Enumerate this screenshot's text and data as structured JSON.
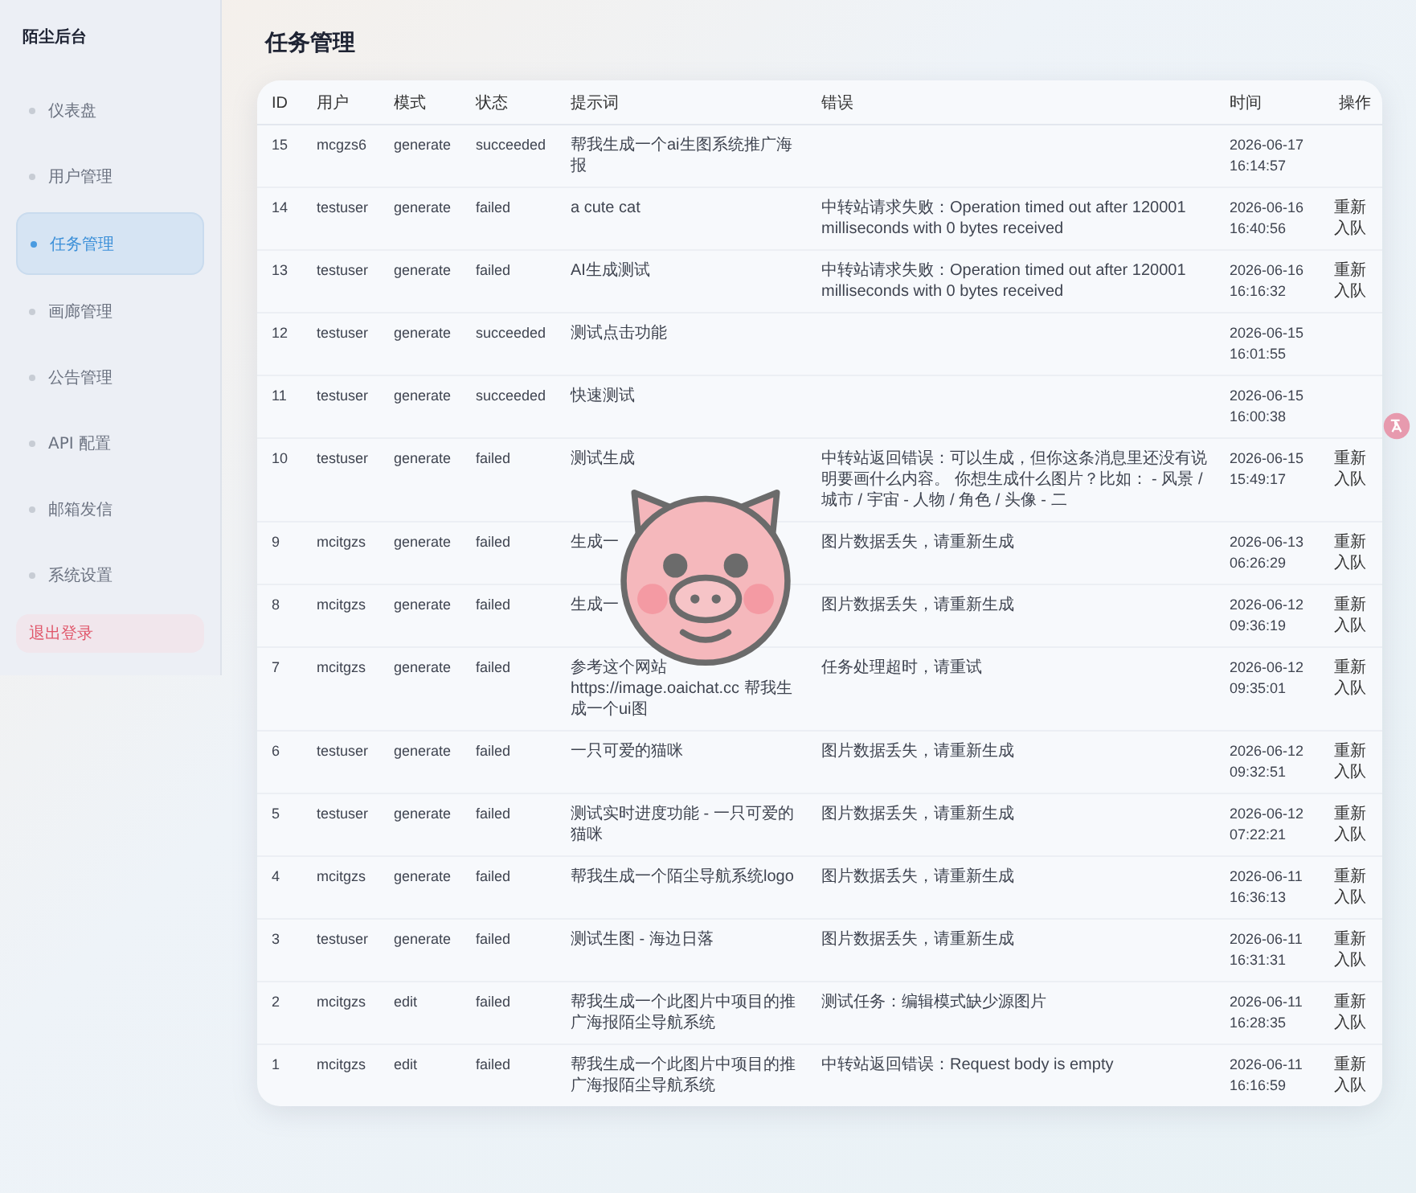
{
  "sidebar": {
    "title": "陌尘后台",
    "items": [
      {
        "label": "仪表盘",
        "selected": false
      },
      {
        "label": "用户管理",
        "selected": false
      },
      {
        "label": "任务管理",
        "selected": true
      },
      {
        "label": "画廊管理",
        "selected": false
      },
      {
        "label": "公告管理",
        "selected": false
      },
      {
        "label": "API 配置",
        "selected": false
      },
      {
        "label": "邮箱发信",
        "selected": false
      },
      {
        "label": "系统设置",
        "selected": false
      }
    ],
    "logout": "退出登录"
  },
  "page_title": "任务管理",
  "table": {
    "columns": [
      "ID",
      "用户",
      "模式",
      "状态",
      "提示词",
      "错误",
      "时间",
      "操作"
    ],
    "rows": [
      {
        "id": "15",
        "user": "mcgzs6",
        "mode": "generate",
        "status": "succeeded",
        "prompt": "帮我生成一个ai生图系统推广海报",
        "time": "2026-06-17 16:14:57"
      },
      {
        "id": "14",
        "user": "testuser",
        "mode": "generate",
        "status": "failed",
        "prompt": "a cute cat",
        "error": "中转站请求失败：Operation timed out after 120001 milliseconds with 0 bytes received",
        "time": "2026-06-16 16:40:56",
        "action": "重新入队"
      },
      {
        "id": "13",
        "user": "testuser",
        "mode": "generate",
        "status": "failed",
        "prompt": "AI生成测试",
        "error": "中转站请求失败：Operation timed out after 120001 milliseconds with 0 bytes received",
        "time": "2026-06-16 16:16:32",
        "action": "重新入队"
      },
      {
        "id": "12",
        "user": "testuser",
        "mode": "generate",
        "status": "succeeded",
        "prompt": "测试点击功能",
        "time": "2026-06-15 16:01:55"
      },
      {
        "id": "11",
        "user": "testuser",
        "mode": "generate",
        "status": "succeeded",
        "prompt": "快速测试",
        "time": "2026-06-15 16:00:38"
      },
      {
        "id": "10",
        "user": "testuser",
        "mode": "generate",
        "status": "failed",
        "prompt": "测试生成",
        "error": "中转站返回错误：可以生成，但你这条消息里还没有说明要画什么内容。 你想生成什么图片？比如： - 风景 / 城市 / 宇宙 - 人物 / 角色 / 头像 - 二",
        "time": "2026-06-15 15:49:17",
        "action": "重新入队"
      },
      {
        "id": "9",
        "user": "mcitgzs",
        "mode": "generate",
        "status": "failed",
        "prompt": "生成一",
        "error": "图片数据丢失，请重新生成",
        "time": "2026-06-13 06:26:29",
        "action": "重新入队"
      },
      {
        "id": "8",
        "user": "mcitgzs",
        "mode": "generate",
        "status": "failed",
        "prompt": "生成一",
        "error": "图片数据丢失，请重新生成",
        "time": "2026-06-12 09:36:19",
        "action": "重新入队"
      },
      {
        "id": "7",
        "user": "mcitgzs",
        "mode": "generate",
        "status": "failed",
        "prompt": "参考这个网站 https://image.oaichat.cc 帮我生成一个ui图",
        "error": "任务处理超时，请重试",
        "time": "2026-06-12 09:35:01",
        "action": "重新入队"
      },
      {
        "id": "6",
        "user": "testuser",
        "mode": "generate",
        "status": "failed",
        "prompt": "一只可爱的猫咪",
        "error": "图片数据丢失，请重新生成",
        "time": "2026-06-12 09:32:51",
        "action": "重新入队"
      },
      {
        "id": "5",
        "user": "testuser",
        "mode": "generate",
        "status": "failed",
        "prompt": "测试实时进度功能 - 一只可爱的猫咪",
        "error": "图片数据丢失，请重新生成",
        "time": "2026-06-12 07:22:21",
        "action": "重新入队"
      },
      {
        "id": "4",
        "user": "mcitgzs",
        "mode": "generate",
        "status": "failed",
        "prompt": "帮我生成一个陌尘导航系统logo",
        "error": "图片数据丢失，请重新生成",
        "time": "2026-06-11 16:36:13",
        "action": "重新入队"
      },
      {
        "id": "3",
        "user": "testuser",
        "mode": "generate",
        "status": "failed",
        "prompt": "测试生图 - 海边日落",
        "error": "图片数据丢失，请重新生成",
        "time": "2026-06-11 16:31:31",
        "action": "重新入队"
      },
      {
        "id": "2",
        "user": "mcitgzs",
        "mode": "edit",
        "status": "failed",
        "prompt": "帮我生成一个此图片中项目的推广海报陌尘导航系统",
        "error": "测试任务：编辑模式缺少源图片",
        "time": "2026-06-11 16:28:35",
        "action": "重新入队"
      },
      {
        "id": "1",
        "user": "mcitgzs",
        "mode": "edit",
        "status": "failed",
        "prompt": "帮我生成一个此图片中项目的推广海报陌尘导航系统",
        "error": "中转站返回错误：Request body is empty",
        "time": "2026-06-11 16:16:59",
        "action": "重新入队"
      }
    ]
  }
}
